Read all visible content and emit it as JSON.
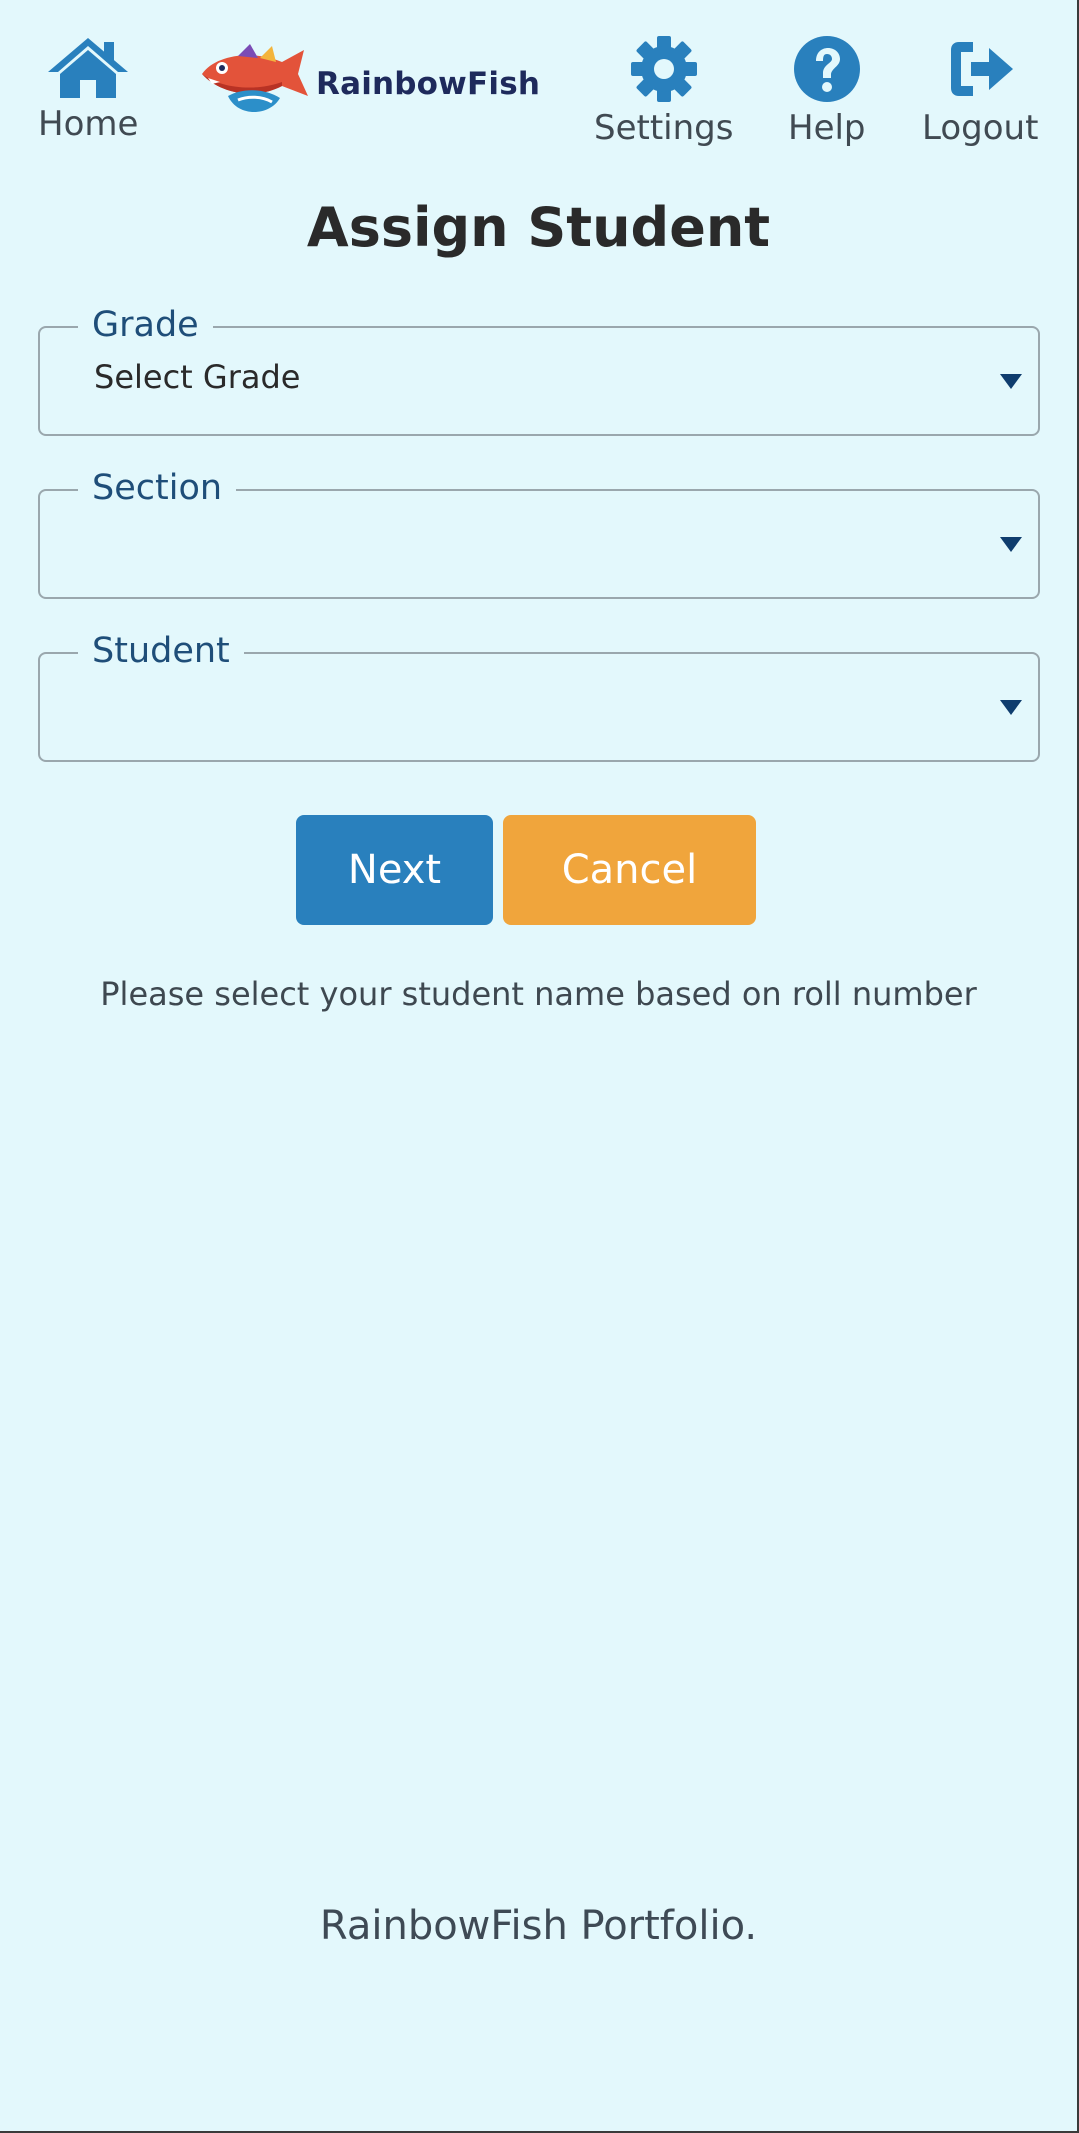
{
  "nav": {
    "home": {
      "label": "Home",
      "icon": "home-icon"
    },
    "settings": {
      "label": "Settings",
      "icon": "gear-icon"
    },
    "help": {
      "label": "Help",
      "icon": "question-icon"
    },
    "logout": {
      "label": "Logout",
      "icon": "sign-out-icon"
    }
  },
  "brand": {
    "name": "RainbowFish"
  },
  "page": {
    "title": "Assign Student"
  },
  "form": {
    "grade": {
      "label": "Grade",
      "value": "Select Grade"
    },
    "section": {
      "label": "Section",
      "value": ""
    },
    "student": {
      "label": "Student",
      "value": ""
    }
  },
  "actions": {
    "next_label": "Next",
    "cancel_label": "Cancel"
  },
  "hint": "Please select your student name based on roll number",
  "footer": "RainbowFish Portfolio.",
  "colors": {
    "background": "#e3f8fc",
    "icon": "#2980bd",
    "next_button": "#2980bd",
    "cancel_button": "#f0a53c",
    "legend": "#1f4e79"
  }
}
